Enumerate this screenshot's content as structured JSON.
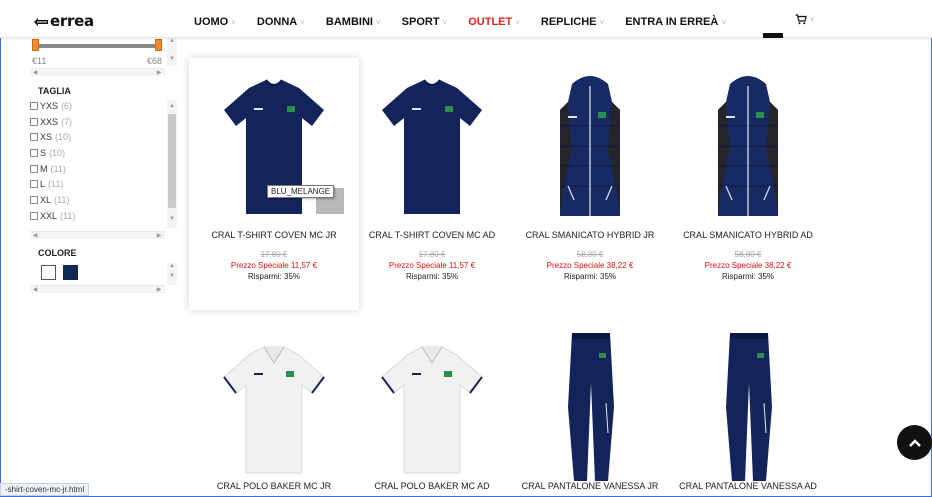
{
  "header": {
    "logo_text": "errea",
    "nav": [
      {
        "label": "UOMO",
        "chevron": "˅"
      },
      {
        "label": "DONNA",
        "chevron": "˅"
      },
      {
        "label": "BAMBINI",
        "chevron": "˅"
      },
      {
        "label": "SPORT",
        "chevron": "˅"
      },
      {
        "label": "OUTLET",
        "chevron": "˅"
      },
      {
        "label": "REPLICHE",
        "chevron": "˅"
      },
      {
        "label": "ENTRA IN ERREÀ",
        "chevron": "˅"
      }
    ],
    "outlet_color": "#e2231a",
    "cart_chevron": "˅"
  },
  "sidebar": {
    "price_min": "€11",
    "price_max": "€68",
    "size_title": "TAGLIA",
    "sizes": [
      {
        "label": "YXS",
        "count": "(6)"
      },
      {
        "label": "XXS",
        "count": "(7)"
      },
      {
        "label": "XS",
        "count": "(10)"
      },
      {
        "label": "S",
        "count": "(10)"
      },
      {
        "label": "M",
        "count": "(11)"
      },
      {
        "label": "L",
        "count": "(11)"
      },
      {
        "label": "XL",
        "count": "(11)"
      },
      {
        "label": "XXL",
        "count": "(11)"
      }
    ],
    "color_title": "COLORE",
    "colors": [
      "#ffffff",
      "#0f2a55"
    ]
  },
  "products": [
    {
      "name": "CRAL T-SHIRT COVEN MC JR",
      "old_price": "17,80 €",
      "special": "Prezzo Speciale 11,57 €",
      "save": "Risparmi: 35%"
    },
    {
      "name": "CRAL T-SHIRT COVEN MC AD",
      "old_price": "17,80 €",
      "special": "Prezzo Speciale 11,57 €",
      "save": "Risparmi: 35%"
    },
    {
      "name": "CRAL SMANICATO HYBRID JR",
      "old_price": "58,80 €",
      "special": "Prezzo Speciale 38,22 €",
      "save": "Risparmi: 35%"
    },
    {
      "name": "CRAL SMANICATO HYBRID AD",
      "old_price": "58,80 €",
      "special": "Prezzo Speciale 38,22 €",
      "save": "Risparmi: 35%"
    },
    {
      "name": "CRAL POLO BAKER MC JR"
    },
    {
      "name": "CRAL POLO BAKER MC AD"
    },
    {
      "name": "CRAL PANTALONE VANESSA JR"
    },
    {
      "name": "CRAL PANTALONE VANESSA AD"
    }
  ],
  "tooltip": "BLU_MELANGE",
  "status_url": "-shirt-coven-mc-jr.html",
  "colors": {
    "navy": "#0f2a55",
    "price_red": "#d11111",
    "range_orange": "#f08c2a"
  }
}
